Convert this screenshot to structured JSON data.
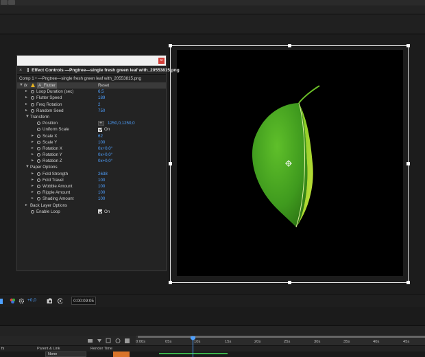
{
  "effect_controls": {
    "tab_title": "Effect Controls —Pngtree—single fresh green leaf with_20553815.png",
    "breadcrumb": "Comp 1 • —Pngtree—single fresh green leaf with_20553815.png",
    "close_glyph": "×",
    "tab_close": "×",
    "effect": {
      "fx": "fx",
      "name": "A_Flutter",
      "reset": "Reset"
    },
    "params": [
      {
        "label": "Loop Duration (sec)",
        "value": "6,5"
      },
      {
        "label": "Flutter Speed",
        "value": "189"
      },
      {
        "label": "Freq Rotation",
        "value": "2"
      },
      {
        "label": "Random Seed",
        "value": "750"
      }
    ],
    "transform": {
      "section": "Transform",
      "position": {
        "label": "Position",
        "value": "1250,0,1250,0"
      },
      "uniform_scale": {
        "label": "Uniform Scale",
        "option": "On",
        "checked": true
      },
      "items": [
        {
          "label": "Scale X",
          "value": "62"
        },
        {
          "label": "Scale Y",
          "value": "100"
        },
        {
          "label": "Rotation X",
          "value": "0x+0,0°"
        },
        {
          "label": "Rotation Y",
          "value": "0x+0,0°"
        },
        {
          "label": "Rotation Z",
          "value": "0x+0,0°"
        }
      ]
    },
    "paper": {
      "section": "Paper Options",
      "items": [
        {
          "label": "Fold Strength",
          "value": "2638"
        },
        {
          "label": "Fold Travel",
          "value": "100"
        },
        {
          "label": "Wobble Amount",
          "value": "100"
        },
        {
          "label": "Ripple Amount",
          "value": "100"
        },
        {
          "label": "Shading Amount",
          "value": "100"
        }
      ]
    },
    "back_layer": {
      "section": "Back Layer Options"
    },
    "enable_loop": {
      "label": "Enable Loop",
      "option": "On",
      "checked": true
    }
  },
  "viewer_bar": {
    "zoom": "+0,0",
    "timecode": "0:00:09:05"
  },
  "timeline": {
    "ruler": [
      "0:00s",
      "05s",
      "10s",
      "15s",
      "20s",
      "25s",
      "30s",
      "35s",
      "40s",
      "45s"
    ],
    "headers": {
      "parent_link": "Parent & Link",
      "render_time": "Render Time"
    },
    "parent_value": "None",
    "playhead_time": "10s"
  },
  "colors": {
    "accent": "#4ea0ff",
    "leaf": "#4caf2a",
    "progress": "#3bb14a",
    "render": "#d9742a"
  }
}
